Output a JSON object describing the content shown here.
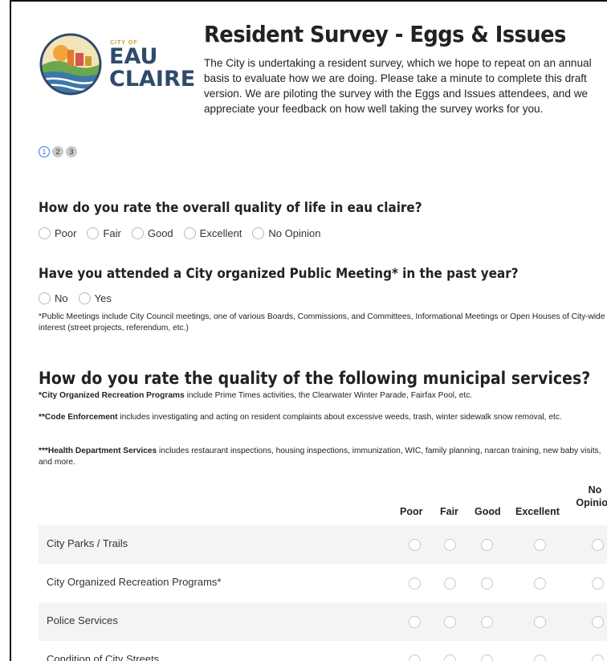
{
  "logo": {
    "city_of": "CITY OF",
    "line1": "EAU",
    "line2": "CLAIRE",
    "colors": {
      "navy": "#2f4a6b",
      "gold": "#c99a2e",
      "green": "#6aa84f",
      "blue": "#3c78a8",
      "orange": "#e07b2a"
    }
  },
  "header": {
    "title": "Resident Survey - Eggs & Issues",
    "intro": "The City is undertaking a resident survey, which we hope to repeat on an annual basis to evaluate how we are doing. Please take a minute to complete this draft version. We are piloting the survey with the Eggs and Issues attendees, and we appreciate your feedback on how well taking the survey works for you."
  },
  "steps": [
    "1",
    "2",
    "3"
  ],
  "q1": {
    "question": "How do you rate the overall quality of life in eau claire?",
    "options": [
      "Poor",
      "Fair",
      "Good",
      "Excellent",
      "No Opinion"
    ]
  },
  "q2": {
    "question": "Have you attended a City organized Public Meeting* in the past year?",
    "options": [
      "No",
      "Yes"
    ],
    "note": "*Public Meetings include City Council meetings, one of various Boards, Commissions, and Committees, Informational Meetings or Open Houses of City-wide interest (street projects, referendum, etc.)"
  },
  "q3": {
    "question": "How do you rate the quality of the following municipal services?",
    "notes": [
      {
        "bold": "*City Organized Recreation Programs",
        "text": " include Prime Times activities, the Clearwater Winter Parade, Fairfax Pool, etc."
      },
      {
        "bold": "**Code Enforcement",
        "text": " includes investigating and acting on resident complaints about excessive weeds, trash, winter sidewalk snow removal, etc."
      },
      {
        "bold": "***Health Department Services",
        "text": " includes restaurant inspections, housing inspections, immunization, WIC, family planning, narcan training, new baby visits, and more."
      }
    ],
    "columns": [
      "Poor",
      "Fair",
      "Good",
      "Excellent",
      "No Opinion"
    ],
    "rows": [
      "City Parks / Trails",
      "City Organized Recreation Programs*",
      "Police Services",
      "Condition of City Streets"
    ]
  }
}
